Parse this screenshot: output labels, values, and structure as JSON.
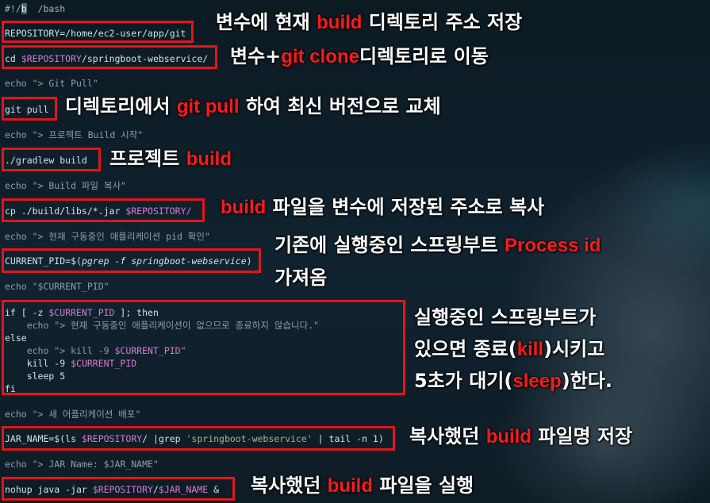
{
  "script_lines": {
    "shebang_pre": "#!/",
    "shebang_hl": "b",
    "shebang_post": "  /bash",
    "repository": "REPOSITORY=/home/ec2-user/app/git",
    "cd_cmd": "cd ",
    "cd_var": "$REPOSITORY",
    "cd_path": "/springboot-webservice/",
    "echo_git_pull": "echo \"> Git Pull\"",
    "git_pull": "git pull",
    "echo_build_start": "echo \"> 프로젝트 Build 시작\"",
    "gradlew_build": "./gradlew build",
    "echo_copy": "echo \"> Build 파일 복사\"",
    "cp_cmd": "cp ./build/libs/*.jar ",
    "cp_var": "$REPOSITORY/",
    "echo_check_pid": "echo \"> 현재 구동중인 애플리케이션 pid 확인\"",
    "current_pid_pre": "CURRENT_PID=$(",
    "current_pid_cmd": "pgrep -f springboot-webservice",
    "current_pid_post": ")",
    "echo_current_pid": "echo \"$CURRENT_PID\"",
    "if_line_pre": "if [ -z ",
    "if_line_var": "$CURRENT_PID",
    "if_line_post": " ]; then",
    "if_echo": "    echo \"> 현재 구동중인 애플리케이션이 없으므로 종료하지 않습니다.\"",
    "else": "else",
    "else_echo_pre": "    echo \"> kill -9 ",
    "else_echo_var": "$CURRENT_PID",
    "else_echo_post": "\"",
    "kill_pre": "    kill -9 ",
    "kill_var": "$CURRENT_PID",
    "sleep": "    sleep 5",
    "fi": "fi",
    "echo_deploy": "echo \"> 새 어플리케이션 배포\"",
    "jar_name_pre": "JAR_NAME=$(ls ",
    "jar_name_var": "$REPOSITORY",
    "jar_name_mid": "/ |grep ",
    "jar_name_str": "'springboot-webservice'",
    "jar_name_post": " | tail -n 1)",
    "echo_jar_name": "echo \"> JAR Name: $JAR_NAME\"",
    "nohup_pre": "nohup java -jar ",
    "nohup_var": "$REPOSITORY",
    "nohup_mid": "/",
    "nohup_var2": "$JAR_NAME",
    "nohup_post": " &"
  },
  "annotations": {
    "a1_pre": "변수에 현재 ",
    "a1_en": "build",
    "a1_post": " 디렉토리 주소 저장",
    "a2_pre": "변수+",
    "a2_en": "git clone",
    "a2_post": "디렉토리로 이동",
    "a3_pre": "디렉토리에서 ",
    "a3_en": "git pull",
    "a3_post": " 하여 최신 버전으로 교체",
    "a4_pre": "프로젝트 ",
    "a4_en": "build",
    "a5_en": "build",
    "a5_post": " 파일을 변수에 저장된 주소로 복사",
    "a6_pre": "기존에 실행중인 스프링부트 ",
    "a6_en": "Process id",
    "a6_line2": "가져옴",
    "a7_line1": "실행중인 스프링부트가",
    "a7_line2_pre": "있으면 종료(",
    "a7_line2_en": "kill",
    "a7_line2_post": ")시키고",
    "a7_line3_pre": "5초가 대기(",
    "a7_line3_en": "sleep",
    "a7_line3_post": ")한다.",
    "a8_pre": "복사했던 ",
    "a8_en": "build",
    "a8_post": " 파일명 저장",
    "a9_pre": "복사했던 ",
    "a9_en": "build",
    "a9_post": " 파일을 실행"
  },
  "colors": {
    "highlight_box": "#e0161b",
    "annotation_en": "#ff1a1a",
    "variable": "#d77bd2"
  }
}
